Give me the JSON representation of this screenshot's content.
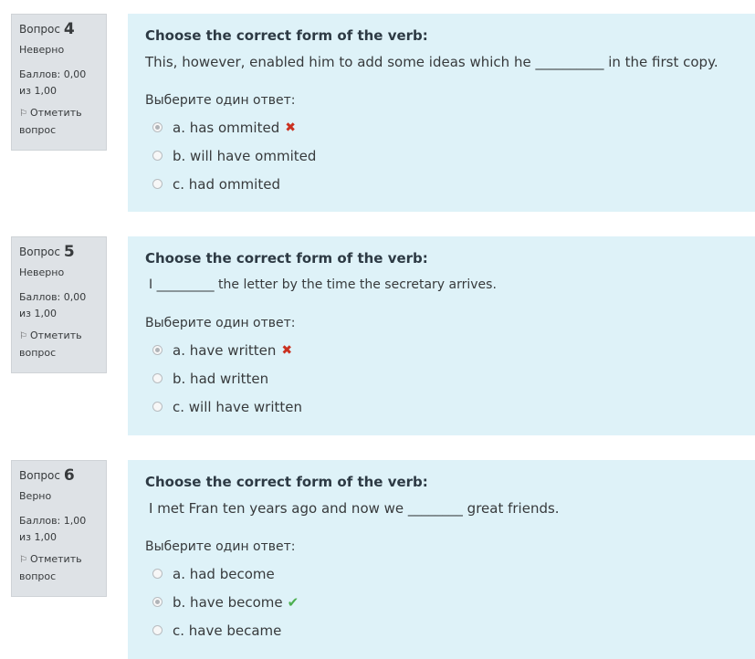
{
  "questions": [
    {
      "label": "Вопрос",
      "number": "4",
      "state": "Неверно",
      "grade": "Баллов: 0,00 из 1,00",
      "flag": "Отметить вопрос",
      "title": "Choose the correct form of the verb:",
      "text": "This, however, enabled him to add some ideas which he __________ in the first copy.",
      "prompt": "Выберите один ответ:",
      "options": [
        {
          "label": "a. has ommited",
          "selected": true,
          "mark": "✖"
        },
        {
          "label": "b. will have ommited",
          "selected": false,
          "mark": ""
        },
        {
          "label": "c. had ommited",
          "selected": false,
          "mark": ""
        }
      ]
    },
    {
      "label": "Вопрос",
      "number": "5",
      "state": "Неверно",
      "grade": "Баллов: 0,00 из 1,00",
      "flag": "Отметить вопрос",
      "title": "Choose the correct form of the verb:",
      "text": "I _________ the letter by the time the secretary arrives.",
      "prompt": "Выберите один ответ:",
      "options": [
        {
          "label": "a. have written",
          "selected": true,
          "mark": "✖"
        },
        {
          "label": "b. had written",
          "selected": false,
          "mark": ""
        },
        {
          "label": "c. will have written",
          "selected": false,
          "mark": ""
        }
      ]
    },
    {
      "label": "Вопрос",
      "number": "6",
      "state": "Верно",
      "grade": "Баллов: 1,00 из 1,00",
      "flag": "Отметить вопрос",
      "title": "Choose the correct form of the verb:",
      "text": "I met Fran ten years ago and now we ________ great friends.",
      "prompt": "Выберите один ответ:",
      "options": [
        {
          "label": "a. had become",
          "selected": false,
          "mark": ""
        },
        {
          "label": "b. have become",
          "selected": true,
          "mark": "✔"
        },
        {
          "label": "c. have became",
          "selected": false,
          "mark": ""
        }
      ]
    }
  ]
}
